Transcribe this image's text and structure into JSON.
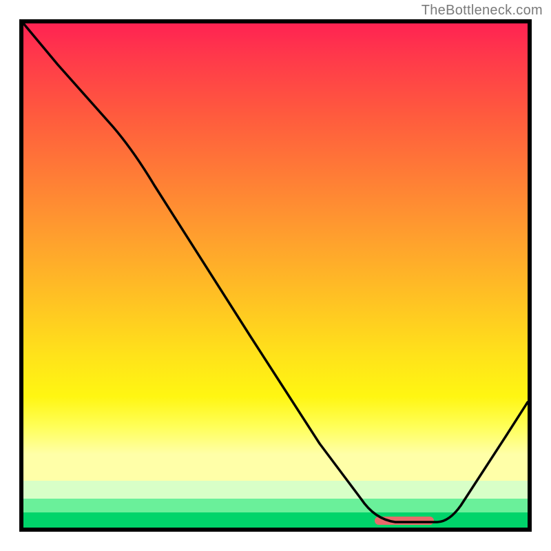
{
  "attribution": "TheBottleneck.com",
  "chart_data": {
    "type": "line",
    "title": "",
    "xlabel": "",
    "ylabel": "",
    "x": [
      0.0,
      0.1,
      0.2,
      0.3,
      0.4,
      0.5,
      0.6,
      0.65,
      0.7,
      0.78,
      0.82,
      0.9,
      1.0
    ],
    "values": [
      100,
      88,
      76,
      60,
      44,
      28,
      12,
      5,
      1,
      0,
      0,
      8,
      24
    ],
    "ylim": [
      0,
      100
    ],
    "xlim": [
      0,
      1
    ],
    "accent_range_x": [
      0.7,
      0.82
    ],
    "background": "red-to-green vertical gradient",
    "notes": "V-shaped bottleneck curve; minimum (optimal zone) near x≈0.75–0.82 highlighted by small red bar at bottom."
  }
}
